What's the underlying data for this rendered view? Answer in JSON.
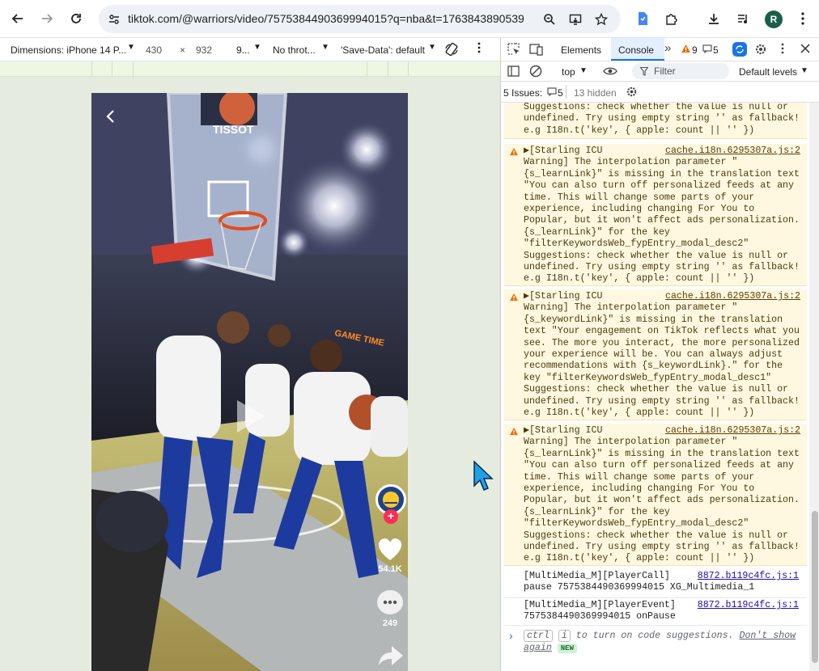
{
  "browser": {
    "url": "tiktok.com/@warriors/video/7575384490369994015?q=nba&t=1763843890539",
    "profile_initial": "R",
    "icons": [
      "back-icon",
      "forward-icon",
      "reload-icon",
      "site-info-icon",
      "zoom-icon",
      "cast-icon",
      "bookmark-star-icon",
      "extension-icon",
      "puzzle-icon",
      "download-icon",
      "media-icon",
      "menu-icon"
    ]
  },
  "device_toolbar": {
    "dimensions_label": "Dimensions: iPhone 14 P...",
    "width": "430",
    "times": "×",
    "height": "932",
    "zoom": "9...",
    "throttle": "No throt...",
    "save_data": "'Save-Data': default"
  },
  "video": {
    "likes": "54.1K",
    "comments": "249",
    "jersey_text": "GAME TIME",
    "scoreboard": "TISSOT"
  },
  "devtools": {
    "tabs": {
      "elements": "Elements",
      "console": "Console",
      "more": "»"
    },
    "counts": {
      "warnings": "9",
      "messages": "5"
    },
    "context": "top",
    "filter_placeholder": "Filter",
    "levels": "Default levels",
    "issues": {
      "label": "5 Issues:",
      "count": "5",
      "hidden": "13 hidden"
    }
  },
  "console": {
    "top_fragment": "Suggestions: check whether the value is null or\nundefined. Try using empty string '' as fallback!\ne.g I18n.t('key', { apple: count || '' })",
    "warnings": [
      {
        "source": "cache.i18n.6295307a.js:2",
        "text": "▶[Starling ICU\nWarning] The interpolation parameter \"\n{s_learnLink}\" is missing in the translation text\n\"You can also turn off personalized feeds at any\ntime. This will change some parts of your\nexperience, including changing For You to\nPopular, but it won't affect ads personalization.\n{s_learnLink}\" for the key\n\"filterKeywordsWeb_fypEntry_modal_desc2\"\nSuggestions: check whether the value is null or\nundefined. Try using empty string '' as fallback!\ne.g I18n.t('key', { apple: count || '' })"
      },
      {
        "source": "cache.i18n.6295307a.js:2",
        "text": "▶[Starling ICU\nWarning] The interpolation parameter \"\n{s_keywordLink}\" is missing in the translation\ntext \"Your engagement on TikTok reflects what you\nsee. The more you interact, the more personalized\nyour experience will be. You can always adjust\nrecommendations with {s_keywordLink}.\" for the\nkey \"filterKeywordsWeb_fypEntry_modal_desc1\"\nSuggestions: check whether the value is null or\nundefined. Try using empty string '' as fallback!\ne.g I18n.t('key', { apple: count || '' })"
      },
      {
        "source": "cache.i18n.6295307a.js:2",
        "text": "▶[Starling ICU\nWarning] The interpolation parameter \"\n{s_learnLink}\" is missing in the translation text\n\"You can also turn off personalized feeds at any\ntime. This will change some parts of your\nexperience, including changing For You to\nPopular, but it won't affect ads personalization.\n{s_learnLink}\" for the key\n\"filterKeywordsWeb_fypEntry_modal_desc2\"\nSuggestions: check whether the value is null or\nundefined. Try using empty string '' as fallback!\ne.g I18n.t('key', { apple: count || '' })"
      }
    ],
    "logs": [
      {
        "source": "8872.b119c4fc.js:1",
        "text": "[MultiMedia_M][PlayerCall]\npause 7575384490369994015 XG_Multimedia_1"
      },
      {
        "source": "8872.b119c4fc.js:1",
        "text": "[MultiMedia_M][PlayerEvent]\n7575384490369994015 onPause"
      }
    ],
    "hint": {
      "ctrl": "ctrl",
      "i": "i",
      "text": " to turn on code suggestions.",
      "dont_show": "Don't show again",
      "new_badge": "NEW"
    },
    "prompt": "›"
  }
}
